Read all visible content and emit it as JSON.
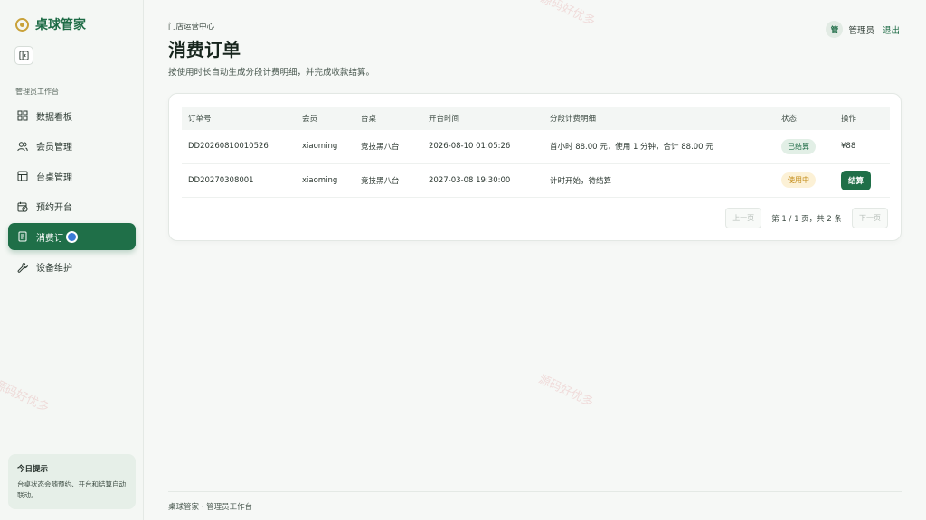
{
  "app": {
    "name": "桌球管家"
  },
  "sidebar": {
    "section": "管理员工作台",
    "items": [
      {
        "label": "数据看板",
        "icon": "grid-icon"
      },
      {
        "label": "会员管理",
        "icon": "users-icon"
      },
      {
        "label": "台桌管理",
        "icon": "table-icon"
      },
      {
        "label": "预约开台",
        "icon": "calendar-clock-icon"
      },
      {
        "label": "消费订",
        "icon": "receipt-icon",
        "active": true
      },
      {
        "label": "设备维护",
        "icon": "wrench-icon"
      }
    ],
    "tip": {
      "title": "今日提示",
      "text": "台桌状态会随预约、开台和结算自动联动。"
    }
  },
  "header": {
    "breadcrumb": "门店运营中心",
    "title": "消费订单",
    "description": "按使用时长自动生成分段计费明细，并完成收款结算。",
    "user": {
      "avatar": "管",
      "name": "管理员",
      "logout": "退出"
    }
  },
  "table": {
    "columns": [
      "订单号",
      "会员",
      "台桌",
      "开台时间",
      "分段计费明细",
      "状态",
      "操作"
    ],
    "rows": [
      {
        "order_no": "DD20260810010526",
        "member": "xiaoming",
        "table": "竞技黑八台",
        "open_time": "2026-08-10 01:05:26",
        "detail": "首小时 88.00 元，使用 1 分钟，合计 88.00 元",
        "status": "已结算",
        "action": "¥88"
      },
      {
        "order_no": "DD20270308001",
        "member": "xiaoming",
        "table": "竞技黑八台",
        "open_time": "2027-03-08 19:30:00",
        "detail": "计时开始，待结算",
        "status": "使用中",
        "action": "结算"
      }
    ]
  },
  "pager": {
    "prev": "上一页",
    "info": "第 1 / 1 页，共 2 条",
    "next": "下一页"
  },
  "footer": "桌球管家 · 管理员工作台",
  "watermark": "源码好优多",
  "colors": {
    "brand": "#1f6f48",
    "accent": "#c9a23a",
    "active_badge": "#c28a16"
  }
}
